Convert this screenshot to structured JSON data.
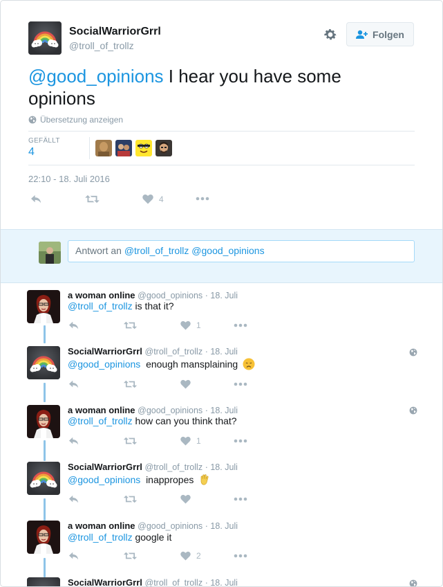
{
  "main_tweet": {
    "display_name": "SocialWarriorGrrl",
    "handle": "@troll_of_trollz",
    "follow_label": "Folgen",
    "text_mention": "@good_opinions",
    "text_body": " I hear you have some opinions",
    "translate_label": "Übersetzung anzeigen",
    "likes_label": "GEFÄLLT",
    "likes_count": "4",
    "timestamp": "22:10 - 18. Juli 2016",
    "like_action_count": "4"
  },
  "reply_box": {
    "prefix": "Antwort an ",
    "mentions": "@troll_of_trollz @good_opinions"
  },
  "thread": [
    {
      "name": "a woman online",
      "handle": "@good_opinions",
      "date": "· 18. Juli",
      "mention": "@troll_of_trollz",
      "text": " is that it?",
      "likes": "1"
    },
    {
      "name": "SocialWarriorGrrl",
      "handle": "@troll_of_trollz",
      "date": "· 18. Juli",
      "mention": "@good_opinions",
      "text": "  enough mansplaining",
      "likes": ""
    },
    {
      "name": "a woman online",
      "handle": "@good_opinions",
      "date": "· 18. Juli",
      "mention": "@troll_of_trollz",
      "text": " how can you think that?",
      "likes": "1"
    },
    {
      "name": "SocialWarriorGrrl",
      "handle": "@troll_of_trollz",
      "date": "· 18. Juli",
      "mention": "@good_opinions",
      "text": "  inappropes",
      "likes": ""
    },
    {
      "name": "a woman online",
      "handle": "@good_opinions",
      "date": "· 18. Juli",
      "mention": "@troll_of_trollz",
      "text": " google it",
      "likes": "2"
    },
    {
      "name": "SocialWarriorGrrl",
      "handle": "@troll_of_trollz",
      "date": "· 18. Juli"
    }
  ],
  "icons": {
    "settings": "gear-icon",
    "follow": "person-plus-icon",
    "globe": "globe-icon",
    "reply": "reply-icon",
    "retweet": "retweet-icon",
    "like": "heart-icon",
    "more": "more-icon"
  },
  "colors": {
    "link": "#1b95e0",
    "muted": "#8899a6",
    "action": "#aab8c2",
    "reply_bg": "#e8f5fd",
    "thread_line": "#8ec4e8"
  }
}
